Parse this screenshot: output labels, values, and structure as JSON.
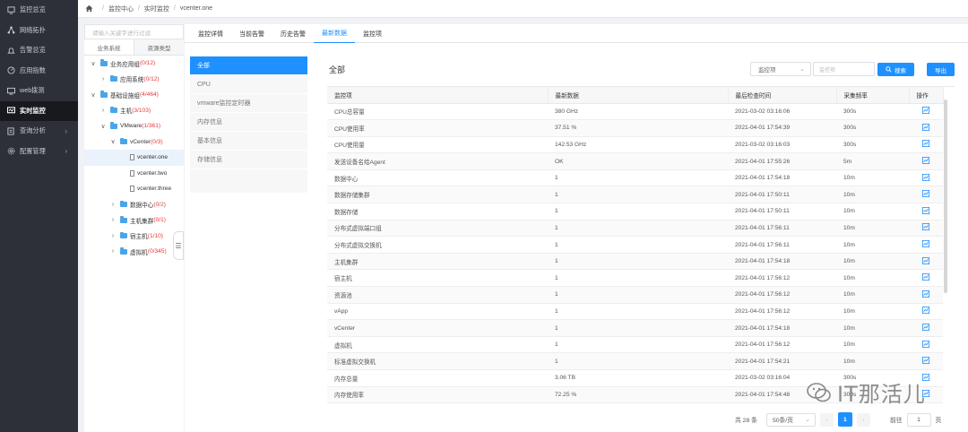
{
  "sidebar": {
    "items": [
      {
        "label": "监控总览",
        "icon": "monitor-icon"
      },
      {
        "label": "网络拓扑",
        "icon": "topology-icon"
      },
      {
        "label": "告警总览",
        "icon": "bell-icon"
      },
      {
        "label": "应用指数",
        "icon": "gauge-icon"
      },
      {
        "label": "web拨测",
        "icon": "screen-icon"
      },
      {
        "label": "实时监控",
        "icon": "realtime-icon",
        "active": true
      },
      {
        "label": "查询分析",
        "icon": "query-icon",
        "arrow": "›"
      },
      {
        "label": "配置管理",
        "icon": "settings-icon",
        "arrow": "›"
      }
    ]
  },
  "breadcrumb": {
    "items": [
      "监控中心",
      "实时监控",
      "vcenter.one"
    ],
    "sep": "/"
  },
  "tree": {
    "search_placeholder": "请输入关键字进行过滤",
    "tabs": [
      "业务系统",
      "资源类型"
    ],
    "nodes": [
      {
        "toggle": "∨",
        "name": "业务应用组",
        "count": "(0/12)",
        "type": "folder",
        "indent": 0
      },
      {
        "toggle": "›",
        "name": "应用系统",
        "count": "(0/12)",
        "type": "folder",
        "indent": 1
      },
      {
        "toggle": "∨",
        "name": "基础设施组",
        "count": "(4/464)",
        "type": "folder",
        "indent": 0
      },
      {
        "toggle": "›",
        "name": "主机",
        "count": "(3/103)",
        "type": "folder",
        "indent": 1
      },
      {
        "toggle": "∨",
        "name": "VMware",
        "count": "(1/361)",
        "type": "folder",
        "indent": 1
      },
      {
        "toggle": "∨",
        "name": "vCenter",
        "count": "(0/3)",
        "type": "folder",
        "indent": 2
      },
      {
        "toggle": "",
        "name": "vcenter.one",
        "count": "",
        "type": "doc",
        "indent": 3,
        "selected": true
      },
      {
        "toggle": "",
        "name": "vcenter.two",
        "count": "",
        "type": "doc",
        "indent": 3
      },
      {
        "toggle": "",
        "name": "vcenter.three",
        "count": "",
        "type": "doc",
        "indent": 3
      },
      {
        "toggle": "›",
        "name": "数据中心",
        "count": "(0/2)",
        "type": "folder",
        "indent": 2
      },
      {
        "toggle": "›",
        "name": "主机集群",
        "count": "(0/1)",
        "type": "folder",
        "indent": 2
      },
      {
        "toggle": "›",
        "name": "宿主机",
        "count": "(1/10)",
        "type": "folder",
        "indent": 2
      },
      {
        "toggle": "›",
        "name": "虚拟机",
        "count": "(0/345)",
        "type": "folder",
        "indent": 2
      }
    ],
    "collapse_glyph": "☰"
  },
  "tabs": [
    {
      "label": "监控详情"
    },
    {
      "label": "当前告警"
    },
    {
      "label": "历史告警"
    },
    {
      "label": "最新数据",
      "active": true
    },
    {
      "label": "监控项"
    }
  ],
  "subnav": [
    {
      "label": "全部",
      "active": true
    },
    {
      "label": "CPU"
    },
    {
      "label": "vmware监控定时器"
    },
    {
      "label": "内存信息"
    },
    {
      "label": "基本信息"
    },
    {
      "label": "存储信息"
    }
  ],
  "content": {
    "title": "全部",
    "filter_label": "监控项",
    "search_placeholder": "监控项",
    "search_button": "搜索",
    "export_button": "导出"
  },
  "table": {
    "columns": [
      "监控项",
      "最新数据",
      "最后检查时间",
      "采集频率",
      "操作"
    ],
    "rows": [
      [
        "CPU总容量",
        "380 GHz",
        "2021-03-02 03:16:06",
        "300s"
      ],
      [
        "CPU使用率",
        "37.51 %",
        "2021-04-01 17:54:39",
        "300s"
      ],
      [
        "CPU使用量",
        "142.53 GHz",
        "2021-03-02 03:16:03",
        "300s"
      ],
      [
        "发送设备名给Agent",
        "OK",
        "2021-04-01 17:55:26",
        "5m"
      ],
      [
        "数据中心",
        "1",
        "2021-04-01 17:54:18",
        "10m"
      ],
      [
        "数据存储集群",
        "1",
        "2021-04-01 17:50:11",
        "10m"
      ],
      [
        "数据存储",
        "1",
        "2021-04-01 17:50:11",
        "10m"
      ],
      [
        "分布式虚拟端口组",
        "1",
        "2021-04-01 17:56:11",
        "10m"
      ],
      [
        "分布式虚拟交换机",
        "1",
        "2021-04-01 17:56:11",
        "10m"
      ],
      [
        "主机集群",
        "1",
        "2021-04-01 17:54:18",
        "10m"
      ],
      [
        "宿主机",
        "1",
        "2021-04-01 17:56:12",
        "10m"
      ],
      [
        "资源池",
        "1",
        "2021-04-01 17:56:12",
        "10m"
      ],
      [
        "vApp",
        "1",
        "2021-04-01 17:56:12",
        "10m"
      ],
      [
        "vCenter",
        "1",
        "2021-04-01 17:54:18",
        "10m"
      ],
      [
        "虚拟机",
        "1",
        "2021-04-01 17:56:12",
        "10m"
      ],
      [
        "标准虚拟交换机",
        "1",
        "2021-04-01 17:54:21",
        "10m"
      ],
      [
        "内存总量",
        "3.06 TB",
        "2021-03-02 03:16:04",
        "300s"
      ],
      [
        "内存使用率",
        "72.25 %",
        "2021-04-01 17:54:48",
        "300s"
      ]
    ]
  },
  "pager": {
    "total": "共 28 条",
    "page_size": "50条/页",
    "prev": "‹",
    "current": "1",
    "next": "›",
    "goto_label": "前往",
    "goto_value": "1",
    "page_suffix": "页"
  },
  "watermark": {
    "text": "IT那活儿"
  },
  "colors": {
    "accent": "#1e90ff",
    "sidebar": "#2d3038",
    "count_red": "#e23b3b"
  }
}
